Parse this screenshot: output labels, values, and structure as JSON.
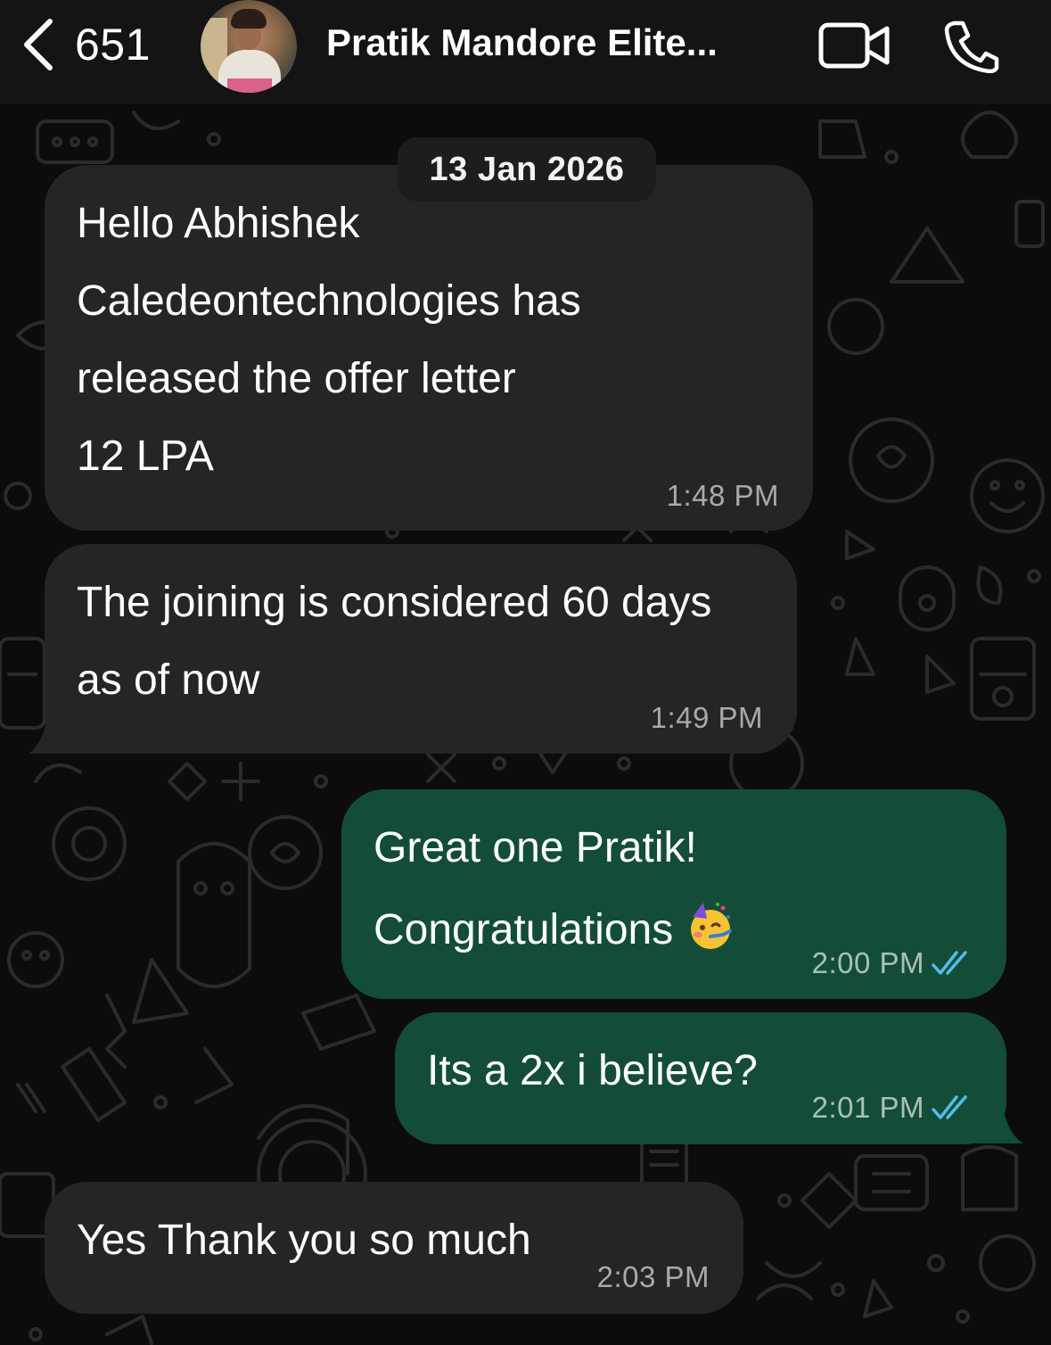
{
  "header": {
    "back_count": "651",
    "contact_name": "Pratik Mandore Elite...",
    "icons": {
      "back": "chevron-left-icon",
      "video": "video-call-icon",
      "phone": "phone-call-icon"
    }
  },
  "date_separator": "13 Jan 2026",
  "messages": [
    {
      "direction": "incoming",
      "lines": [
        "Hello Abhishek",
        "Caledeontechnologies has",
        "released the offer letter",
        "12 LPA"
      ],
      "time": "1:48 PM"
    },
    {
      "direction": "incoming",
      "lines": [
        "The joining is considered 60 days",
        "as of now"
      ],
      "time": "1:49 PM"
    },
    {
      "direction": "outgoing",
      "lines": [
        "Great one Pratik!",
        "Congratulations"
      ],
      "emoji": "partying-face-emoji",
      "time": "2:00 PM",
      "status": "read"
    },
    {
      "direction": "outgoing",
      "lines": [
        "Its a 2x i believe?"
      ],
      "time": "2:01 PM",
      "status": "read"
    },
    {
      "direction": "incoming",
      "lines": [
        "Yes Thank you so much"
      ],
      "time": "2:03 PM"
    }
  ],
  "colors": {
    "header_bg": "#141414",
    "incoming_bubble": "#252525",
    "outgoing_bubble": "#144d37",
    "read_ticks": "#53bdeb"
  }
}
